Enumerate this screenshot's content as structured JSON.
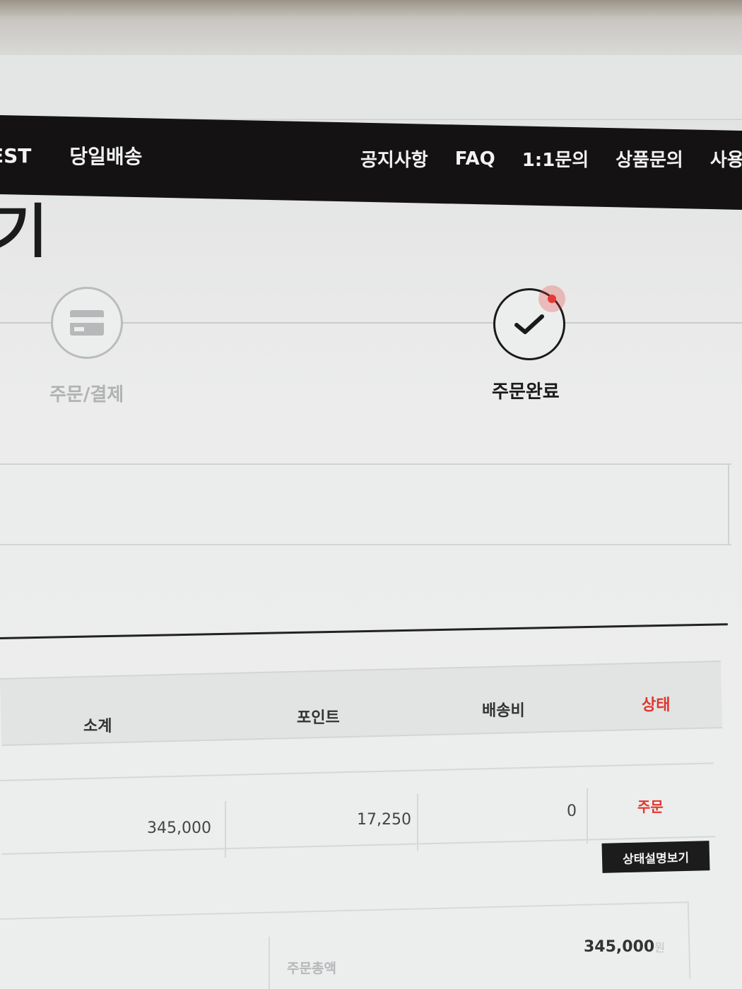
{
  "nav": {
    "left_items": [
      {
        "label": "EST"
      },
      {
        "label": "당일배송"
      }
    ],
    "right_items": [
      {
        "label": "공지사항"
      },
      {
        "label": "FAQ"
      },
      {
        "label": "1:1문의"
      },
      {
        "label": "상품문의"
      },
      {
        "label": "사용후기"
      }
    ]
  },
  "page": {
    "title_fragment": "기"
  },
  "steps": [
    {
      "label": "주문/결제",
      "icon": "credit-card-icon",
      "state": "inactive"
    },
    {
      "label": "주문완료",
      "icon": "checkmark-icon",
      "state": "active"
    }
  ],
  "table": {
    "headers": {
      "subtotal": "소계",
      "point": "포인트",
      "shipping": "배송비",
      "status": "상태"
    },
    "row": {
      "subtotal": "345,000",
      "point": "17,250",
      "shipping": "0",
      "status": "주문"
    },
    "status_button": "상태설명보기"
  },
  "summary": {
    "label": "주문총액",
    "value": "345,000",
    "unit": "원"
  },
  "colors": {
    "accent": "#e0362f",
    "nav_bg": "#141212",
    "button_bg": "#1c1c1c"
  }
}
